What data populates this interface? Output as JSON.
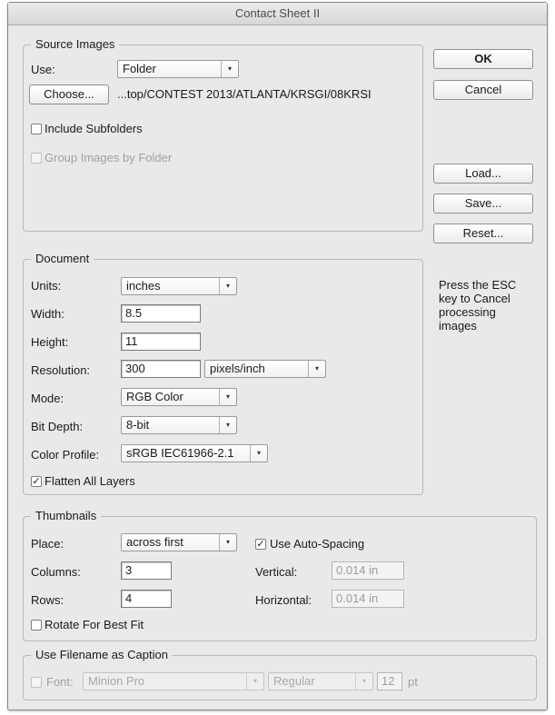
{
  "window": {
    "title": "Contact Sheet II"
  },
  "source": {
    "title": "Source Images",
    "use_label": "Use:",
    "use_value": "Folder",
    "choose_label": "Choose...",
    "path": "...top/CONTEST 2013/ATLANTA/KRSGI/08KRSI",
    "include_subfolders": "Include Subfolders",
    "group_by_folder": "Group Images by Folder"
  },
  "document": {
    "title": "Document",
    "units_label": "Units:",
    "units_value": "inches",
    "width_label": "Width:",
    "width_value": "8.5",
    "height_label": "Height:",
    "height_value": "11",
    "resolution_label": "Resolution:",
    "resolution_value": "300",
    "resolution_unit": "pixels/inch",
    "mode_label": "Mode:",
    "mode_value": "RGB Color",
    "bitdepth_label": "Bit Depth:",
    "bitdepth_value": "8-bit",
    "profile_label": "Color Profile:",
    "profile_value": "sRGB IEC61966-2.1",
    "flatten_label": "Flatten All Layers"
  },
  "thumbnails": {
    "title": "Thumbnails",
    "place_label": "Place:",
    "place_value": "across first",
    "autospacing_label": "Use Auto-Spacing",
    "columns_label": "Columns:",
    "columns_value": "3",
    "rows_label": "Rows:",
    "rows_value": "4",
    "vertical_label": "Vertical:",
    "vertical_value": "0.014 in",
    "horizontal_label": "Horizontal:",
    "horizontal_value": "0.014 in",
    "rotate_label": "Rotate For Best Fit"
  },
  "caption": {
    "title": "Use Filename as Caption",
    "font_label": "Font:",
    "font_value": "Minion Pro",
    "style_value": "Regular",
    "size_value": "12",
    "size_unit": "pt"
  },
  "buttons": {
    "ok": "OK",
    "cancel": "Cancel",
    "load": "Load...",
    "save": "Save...",
    "reset": "Reset..."
  },
  "hint": {
    "line1": "Press the ESC",
    "line2": "key to Cancel",
    "line3": "processing",
    "line4": "images"
  },
  "icons": {
    "dropdown": "▾",
    "check": "✓"
  }
}
